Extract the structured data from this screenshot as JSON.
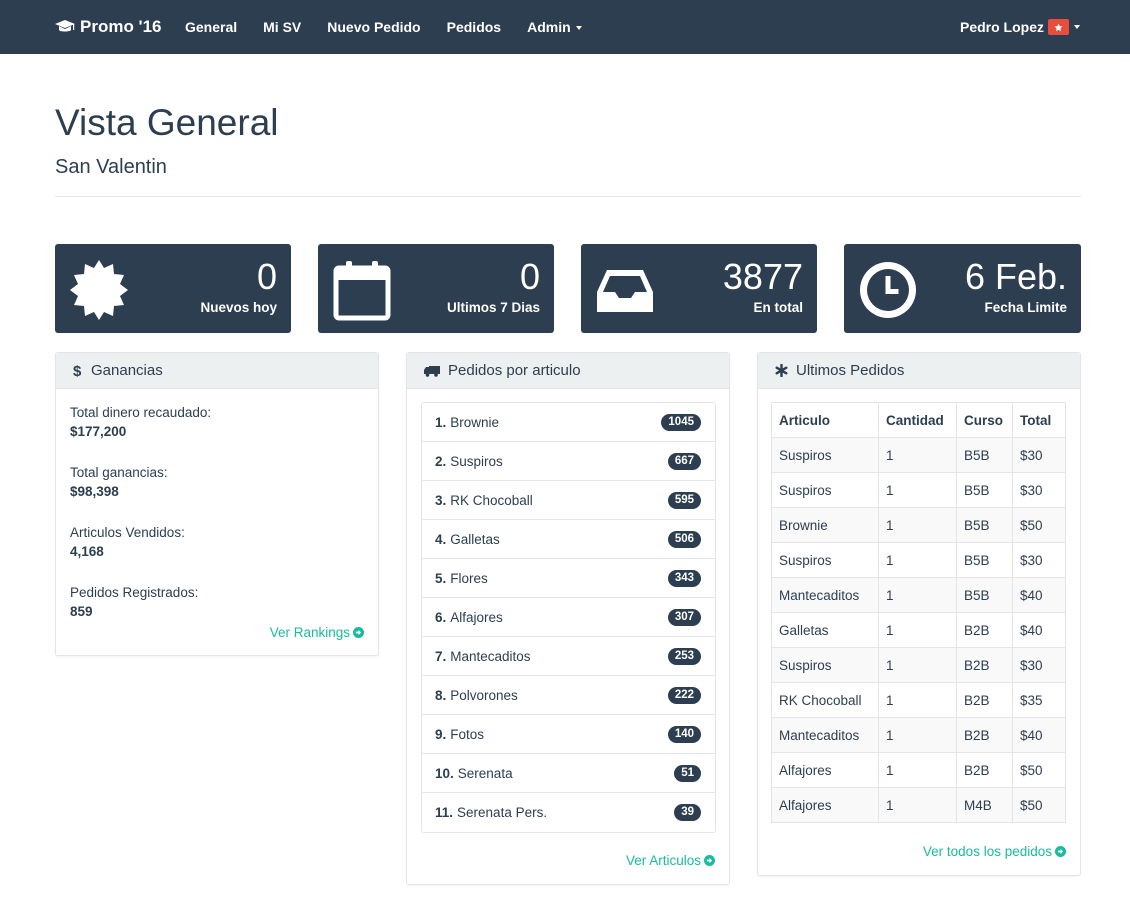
{
  "navbar": {
    "brand": "Promo '16",
    "links": [
      "General",
      "Mi SV",
      "Nuevo Pedido",
      "Pedidos",
      "Admin"
    ],
    "user": "Pedro Lopez"
  },
  "header": {
    "title": "Vista General",
    "subtitle": "San Valentin"
  },
  "tiles": [
    {
      "icon": "badge-icon",
      "value": "0",
      "label": "Nuevos hoy"
    },
    {
      "icon": "calendar-icon",
      "value": "0",
      "label": "Ultimos 7 Dias"
    },
    {
      "icon": "inbox-icon",
      "value": "3877",
      "label": "En total"
    },
    {
      "icon": "clock-icon",
      "value": "6 Feb.",
      "label": "Fecha Limite"
    }
  ],
  "ganancias": {
    "title": "Ganancias",
    "items": [
      {
        "label": "Total dinero recaudado:",
        "value": "$177,200"
      },
      {
        "label": "Total ganancias:",
        "value": "$98,398"
      },
      {
        "label": "Articulos Vendidos:",
        "value": "4,168"
      },
      {
        "label": "Pedidos Registrados:",
        "value": "859"
      }
    ],
    "link": "Ver Rankings"
  },
  "articulos": {
    "title": "Pedidos por articulo",
    "items": [
      {
        "rank": "1.",
        "name": "Brownie",
        "count": "1045"
      },
      {
        "rank": "2.",
        "name": "Suspiros",
        "count": "667"
      },
      {
        "rank": "3.",
        "name": "RK Chocoball",
        "count": "595"
      },
      {
        "rank": "4.",
        "name": "Galletas",
        "count": "506"
      },
      {
        "rank": "5.",
        "name": "Flores",
        "count": "343"
      },
      {
        "rank": "6.",
        "name": "Alfajores",
        "count": "307"
      },
      {
        "rank": "7.",
        "name": "Mantecaditos",
        "count": "253"
      },
      {
        "rank": "8.",
        "name": "Polvorones",
        "count": "222"
      },
      {
        "rank": "9.",
        "name": "Fotos",
        "count": "140"
      },
      {
        "rank": "10.",
        "name": "Serenata",
        "count": "51"
      },
      {
        "rank": "11.",
        "name": "Serenata Pers.",
        "count": "39"
      }
    ],
    "link": "Ver Articulos"
  },
  "ultimos": {
    "title": "Ultimos Pedidos",
    "columns": [
      "Articulo",
      "Cantidad",
      "Curso",
      "Total"
    ],
    "rows": [
      [
        "Suspiros",
        "1",
        "B5B",
        "$30"
      ],
      [
        "Suspiros",
        "1",
        "B5B",
        "$30"
      ],
      [
        "Brownie",
        "1",
        "B5B",
        "$50"
      ],
      [
        "Suspiros",
        "1",
        "B5B",
        "$30"
      ],
      [
        "Mantecaditos",
        "1",
        "B5B",
        "$40"
      ],
      [
        "Galletas",
        "1",
        "B2B",
        "$40"
      ],
      [
        "Suspiros",
        "1",
        "B2B",
        "$30"
      ],
      [
        "RK Chocoball",
        "1",
        "B2B",
        "$35"
      ],
      [
        "Mantecaditos",
        "1",
        "B2B",
        "$40"
      ],
      [
        "Alfajores",
        "1",
        "B2B",
        "$50"
      ],
      [
        "Alfajores",
        "1",
        "M4B",
        "$50"
      ]
    ],
    "link": "Ver todos los pedidos"
  },
  "colors": {
    "primary": "#2c3e50",
    "accent": "#18bc9c",
    "danger": "#e74c3c",
    "panel_heading": "#ecf0f1"
  }
}
